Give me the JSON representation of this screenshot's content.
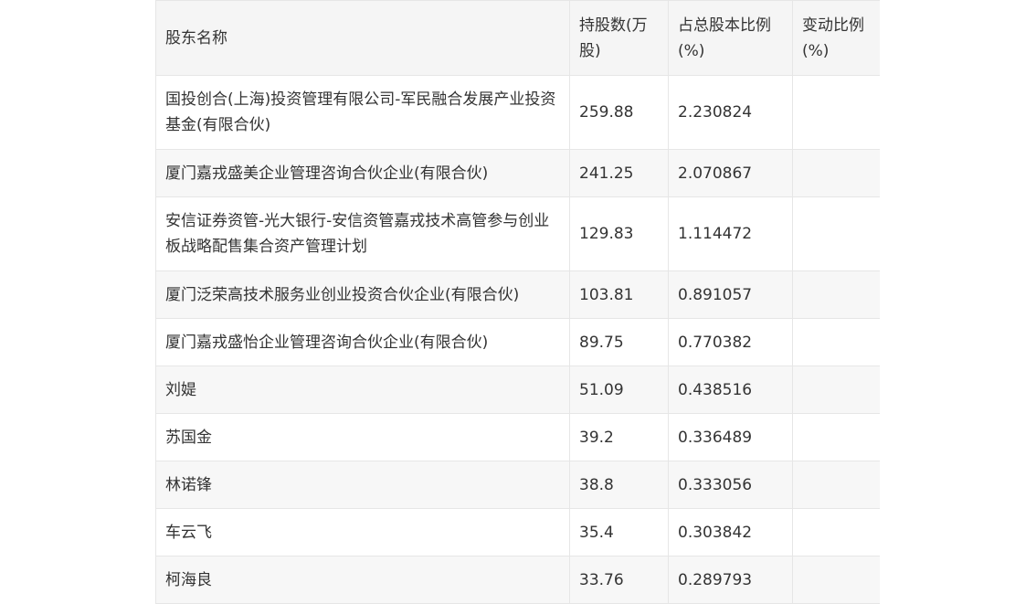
{
  "table": {
    "headers": [
      "股东名称",
      "持股数(万股)",
      "占总股本比例(%)",
      "变动比例(%)"
    ],
    "rows": [
      [
        "国投创合(上海)投资管理有限公司-军民融合发展产业投资基金(有限合伙)",
        "259.88",
        "2.230824",
        ""
      ],
      [
        "厦门嘉戎盛美企业管理咨询合伙企业(有限合伙)",
        "241.25",
        "2.070867",
        ""
      ],
      [
        "安信证券资管-光大银行-安信资管嘉戎技术高管参与创业板战略配售集合资产管理计划",
        "129.83",
        "1.114472",
        ""
      ],
      [
        "厦门泛荣高技术服务业创业投资合伙企业(有限合伙)",
        "103.81",
        "0.891057",
        ""
      ],
      [
        "厦门嘉戎盛怡企业管理咨询合伙企业(有限合伙)",
        "89.75",
        "0.770382",
        ""
      ],
      [
        "刘媞",
        "51.09",
        "0.438516",
        ""
      ],
      [
        "苏国金",
        "39.2",
        "0.336489",
        ""
      ],
      [
        "林诺锋",
        "38.8",
        "0.333056",
        ""
      ],
      [
        "车云飞",
        "35.4",
        "0.303842",
        ""
      ],
      [
        "柯海良",
        "33.76",
        "0.289793",
        ""
      ]
    ]
  }
}
